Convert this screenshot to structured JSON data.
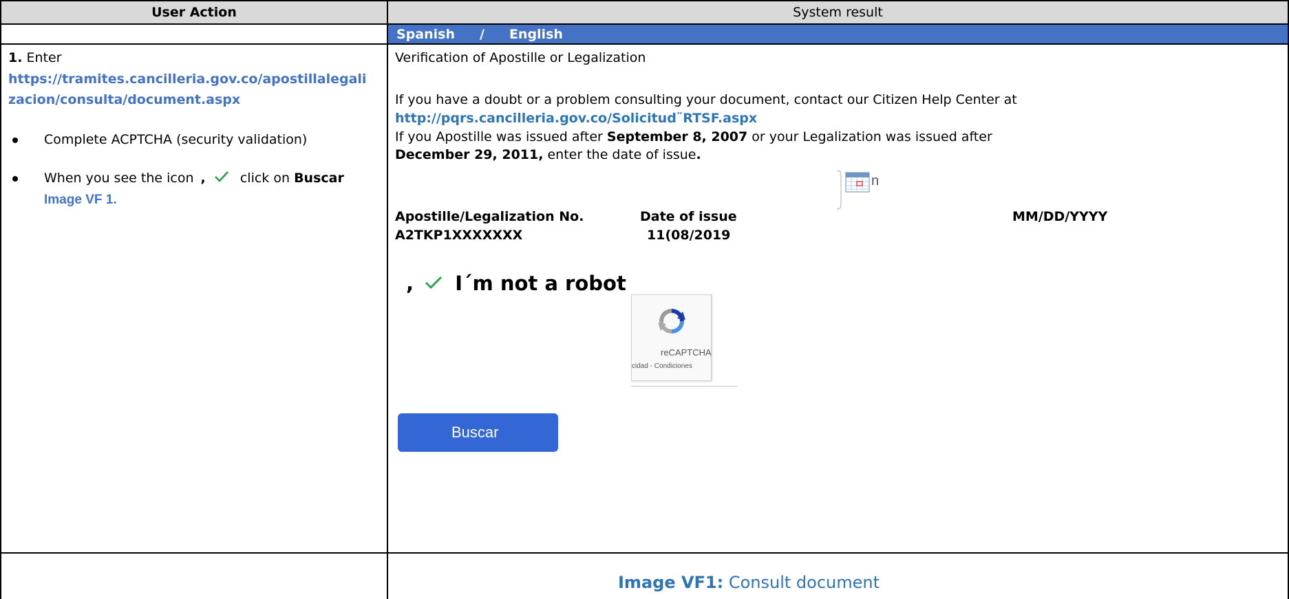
{
  "table": {
    "col_user_action": "User Action",
    "col_system_result": "System result"
  },
  "language_bar": {
    "spanish": "Spanish",
    "separator": "/",
    "english": "English"
  },
  "user_action": {
    "step_number": "1.",
    "step_verb": "Enter",
    "url_line1": "https://tramites.cancilleria.gov.co/apostillalegali",
    "url_line2": "zacion/consulta/document.aspx",
    "bullet1": "Complete ACPTCHA (security validation)",
    "bullet2_prefix": "When you see the icon",
    "bullet2_comma": ",",
    "bullet2_middle": "click on",
    "bullet2_button": "Buscar",
    "image_ref": "Image VF 1."
  },
  "system_result": {
    "page_heading": "Verification of Apostille or Legalization",
    "help_text": "If you have a doubt or a problem consulting your document, contact our Citizen  Help Center at",
    "help_url": "http://pqrs.cancilleria.gov.co/Solicitud¨RTSF.aspx",
    "issue_text_1": "If you Apostille was issued after ",
    "issue_date_1": "September 8, 2007",
    "issue_text_2": " or your Legalization was issued after",
    "issue_date_2": "December 29, 2011,",
    "issue_text_3": " enter the date of issue",
    "issue_text_period": ".",
    "calendar_suffix": "n",
    "apostille_label": "Apostille/Legalization No.",
    "date_label": "Date of issue",
    "date_format": "MM/DD/YYYY",
    "apostille_value": "A2TKP1XXXXXXX",
    "date_value": "11(08/2019",
    "captcha_comma": ",",
    "captcha_text": "I´m not a robot",
    "recaptcha_label": "reCAPTCHA",
    "recaptcha_links": "cidad - Condiciones",
    "search_button": "Buscar"
  },
  "caption": {
    "label": "Image VF1:",
    "text": " Consult document"
  },
  "colors": {
    "header_gray": "#d9d9d9",
    "language_bar_blue": "#4472c4",
    "link_blue": "#4472c4",
    "check_green": "#22a34a",
    "button_blue": "#3367d6",
    "caption_blue": "#2e75b6"
  }
}
